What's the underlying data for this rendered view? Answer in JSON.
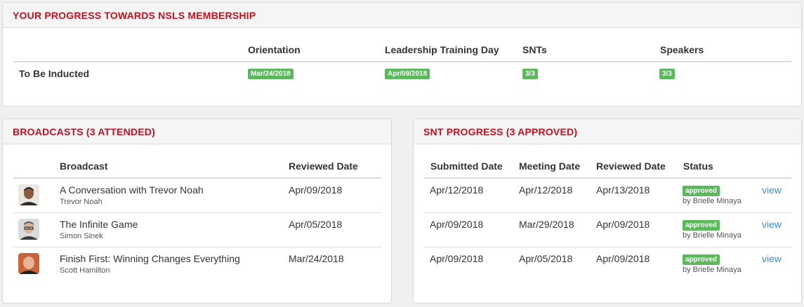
{
  "colors": {
    "accent": "#c1121f",
    "success": "#5cb85c",
    "link": "#3a8fd6"
  },
  "progress": {
    "title": "YOUR PROGRESS TOWARDS NSLS MEMBERSHIP",
    "columns": [
      "Orientation",
      "Leadership Training Day",
      "SNTs",
      "Speakers"
    ],
    "row_label": "To Be Inducted",
    "badges": [
      "Mar/24/2018",
      "Apr/09/2018",
      "3/3",
      "3/3"
    ]
  },
  "broadcasts": {
    "title": "BROADCASTS (3 ATTENDED)",
    "headers": {
      "broadcast": "Broadcast",
      "reviewed": "Reviewed Date"
    },
    "rows": [
      {
        "title": "A Conversation with Trevor Noah",
        "speaker": "Trevor Noah",
        "date": "Apr/09/2018"
      },
      {
        "title": "The Infinite Game",
        "speaker": "Simon Sinek",
        "date": "Apr/05/2018"
      },
      {
        "title": "Finish First: Winning Changes Everything",
        "speaker": "Scott Hamilton",
        "date": "Mar/24/2018"
      }
    ]
  },
  "snt": {
    "title": "SNT PROGRESS (3 APPROVED)",
    "headers": {
      "submitted": "Submitted Date",
      "meeting": "Meeting Date",
      "reviewed": "Reviewed Date",
      "status": "Status"
    },
    "rows": [
      {
        "submitted": "Apr/12/2018",
        "meeting": "Apr/12/2018",
        "reviewed": "Apr/13/2018",
        "status": "approved",
        "by": "by Brielle Minaya",
        "action": "view"
      },
      {
        "submitted": "Apr/09/2018",
        "meeting": "Mar/29/2018",
        "reviewed": "Apr/09/2018",
        "status": "approved",
        "by": "by Brielle Minaya",
        "action": "view"
      },
      {
        "submitted": "Apr/09/2018",
        "meeting": "Apr/05/2018",
        "reviewed": "Apr/09/2018",
        "status": "approved",
        "by": "by Brielle Minaya",
        "action": "view"
      }
    ]
  }
}
